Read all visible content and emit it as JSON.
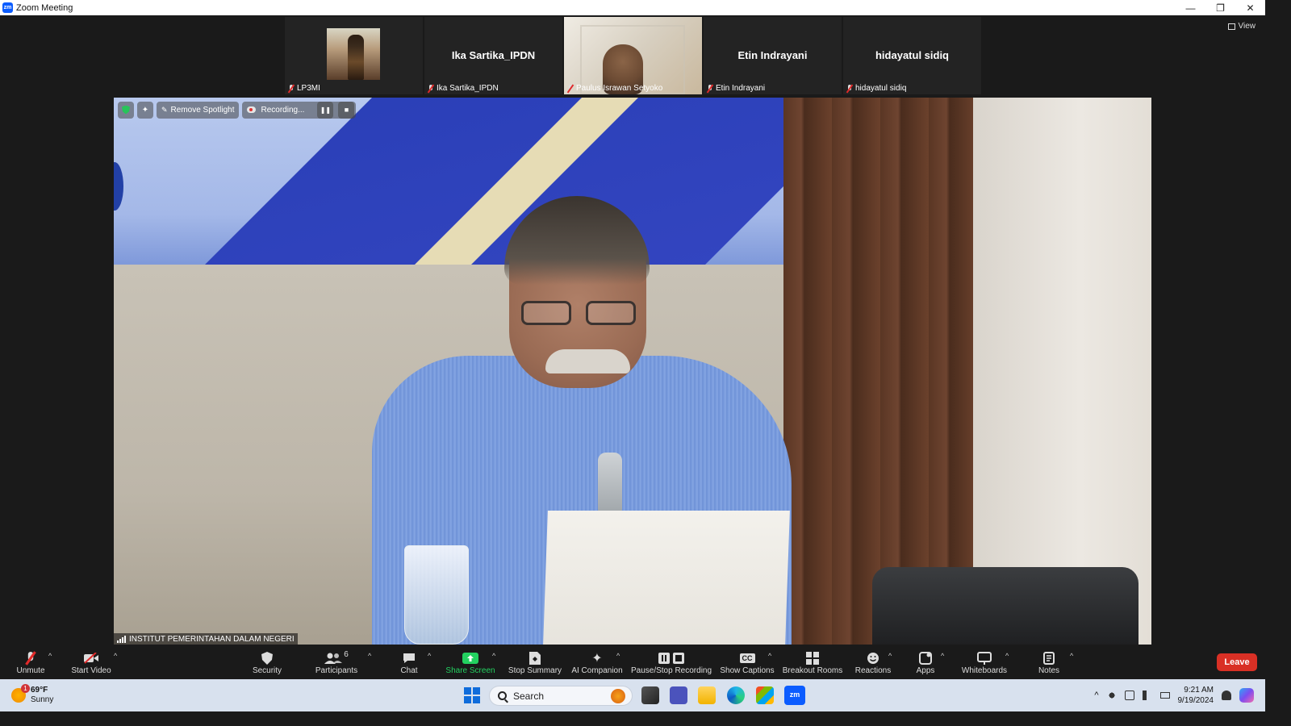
{
  "window": {
    "title": "Zoom Meeting",
    "app_icon": "zm",
    "controls": [
      "—",
      "❐",
      "✕"
    ]
  },
  "view_button": {
    "label": "View"
  },
  "thumbnails": [
    {
      "name": "LP3MI",
      "center_name": "",
      "muted": true,
      "has_video": true
    },
    {
      "name": "Ika Sartika_IPDN",
      "center_name": "Ika Sartika_IPDN",
      "muted": true,
      "has_video": false
    },
    {
      "name": "Paulus Israwan Setyoko",
      "center_name": "",
      "muted": true,
      "has_video": true
    },
    {
      "name": "Etin Indrayani",
      "center_name": "Etin Indrayani",
      "muted": true,
      "has_video": false
    },
    {
      "name": "hidayatul sidiq",
      "center_name": "hidayatul sidiq",
      "muted": true,
      "has_video": false
    }
  ],
  "spotlight_bar": {
    "remove_spotlight": "Remove Spotlight",
    "recording": "Recording...",
    "pause_icon": "❚❚",
    "stop_icon": "■"
  },
  "active_speaker": {
    "name": "INSTITUT PEMERINTAHAN DALAM NEGERI"
  },
  "toolbar": {
    "unmute": "Unmute",
    "start_video": "Start Video",
    "security": "Security",
    "participants": "Participants",
    "participants_count": "6",
    "chat": "Chat",
    "share_screen": "Share Screen",
    "stop_summary": "Stop Summary",
    "ai_companion": "AI Companion",
    "pause_stop_recording": "Pause/Stop Recording",
    "show_captions": "Show Captions",
    "breakout_rooms": "Breakout Rooms",
    "reactions": "Reactions",
    "apps": "Apps",
    "whiteboards": "Whiteboards",
    "notes": "Notes",
    "leave": "Leave",
    "captions_icon_text": "CC"
  },
  "taskbar": {
    "weather_temp": "69°F",
    "weather_desc": "Sunny",
    "weather_badge": "1",
    "search_placeholder": "Search",
    "zoom_app_text": "zm",
    "time": "9:21 AM",
    "date": "9/19/2024"
  },
  "colors": {
    "share_green": "#23d160",
    "leave_red": "#d93025",
    "mute_red": "#e02a2a"
  }
}
